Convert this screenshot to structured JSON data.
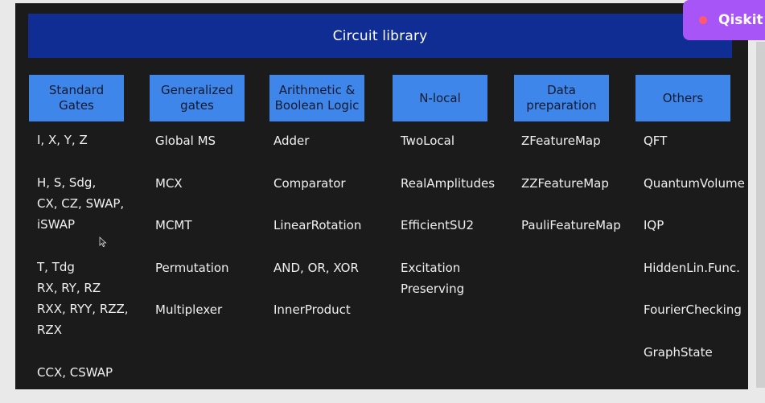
{
  "slide": {
    "title": "Circuit library"
  },
  "badge": {
    "label": "Qiskit",
    "color": "#a855f7",
    "dot_color": "#ff5a6e"
  },
  "colors": {
    "banner": "#0f2d92",
    "header_box": "#3f86ea",
    "slide_bg": "#1b1b1b"
  },
  "columns": [
    {
      "header": "Standard\nGates",
      "items": [
        "I, X, Y, Z",
        "H, S, Sdg,\nCX, CZ, SWAP,\niSWAP",
        "T, Tdg\nRX, RY, RZ\nRXX, RYY, RZZ,\nRZX",
        "CCX, CSWAP"
      ]
    },
    {
      "header": "Generalized\ngates",
      "items": [
        "Global MS",
        "MCX",
        "MCMT",
        "Permutation",
        "Multiplexer"
      ]
    },
    {
      "header": "Arithmetic &\nBoolean Logic",
      "items": [
        "Adder",
        "Comparator",
        "LinearRotation",
        "AND, OR, XOR",
        "InnerProduct"
      ]
    },
    {
      "header": "N-local",
      "items": [
        "TwoLocal",
        "RealAmplitudes",
        "EfficientSU2",
        "Excitation\nPreserving"
      ]
    },
    {
      "header": "Data\npreparation",
      "items": [
        "ZFeatureMap",
        "ZZFeatureMap",
        "PauliFeatureMap"
      ]
    },
    {
      "header": "Others",
      "items": [
        "QFT",
        "QuantumVolume",
        "IQP",
        "HiddenLin.Func.",
        "FourierChecking",
        "GraphState"
      ]
    }
  ]
}
